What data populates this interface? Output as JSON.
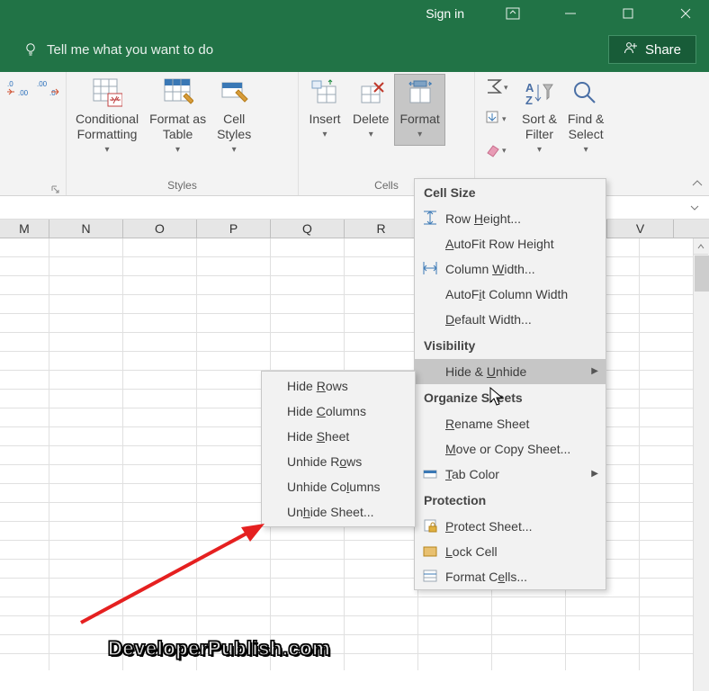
{
  "titlebar": {
    "sign_in": "Sign in"
  },
  "tellme": {
    "placeholder": "Tell me what you want to do",
    "share": "Share"
  },
  "ribbon": {
    "number": {
      "group": ""
    },
    "styles": {
      "group": "Styles",
      "cond_fmt": "Conditional\nFormatting",
      "fmt_table": "Format as\nTable",
      "cell_styles": "Cell\nStyles"
    },
    "cells": {
      "group": "Cells",
      "insert": "Insert",
      "delete": "Delete",
      "format": "Format"
    },
    "editing": {
      "sort": "Sort &\nFilter",
      "find": "Find &\nSelect"
    }
  },
  "columns": [
    "M",
    "N",
    "O",
    "P",
    "Q",
    "R",
    "",
    "",
    "V"
  ],
  "menu": {
    "cell_size": "Cell Size",
    "row_height": "Row Height...",
    "autofit_row": "AutoFit Row Height",
    "col_width": "Column Width...",
    "autofit_col": "AutoFit Column Width",
    "default_width": "Default Width...",
    "visibility": "Visibility",
    "hide_unhide": "Hide & Unhide",
    "organize": "Organize Sheets",
    "rename": "Rename Sheet",
    "move_copy": "Move or Copy Sheet...",
    "tab_color": "Tab Color",
    "protection": "Protection",
    "protect_sheet": "Protect Sheet...",
    "lock_cell": "Lock Cell",
    "format_cells": "Format Cells..."
  },
  "submenu": {
    "hide_rows": "Hide Rows",
    "hide_cols": "Hide Columns",
    "hide_sheet": "Hide Sheet",
    "unhide_rows": "Unhide Rows",
    "unhide_cols": "Unhide Columns",
    "unhide_sheet": "Unhide Sheet..."
  },
  "watermark": "DeveloperPublish.com"
}
